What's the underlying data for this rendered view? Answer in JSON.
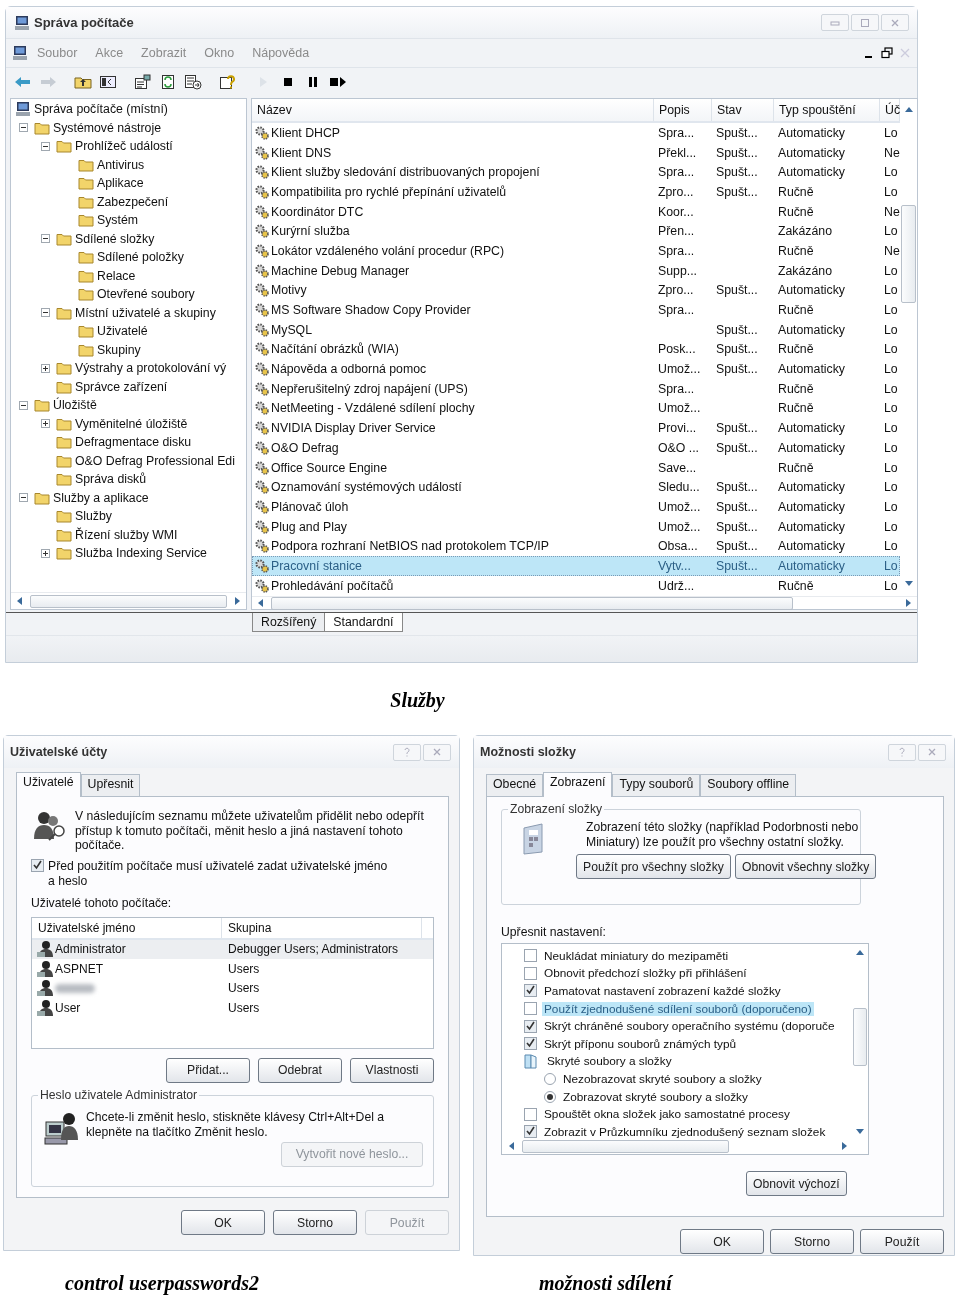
{
  "top_window": {
    "title": "Správa počítače",
    "menu": [
      "Soubor",
      "Akce",
      "Zobrazit",
      "Okno",
      "Nápověda"
    ],
    "tree": [
      {
        "label": "Správa počítače (místní)",
        "children": [
          {
            "label": "Systémové nástroje",
            "expanded": true,
            "children": [
              {
                "label": "Prohlížeč událostí",
                "expanded": true,
                "children": [
                  {
                    "label": "Antivirus"
                  },
                  {
                    "label": "Aplikace"
                  },
                  {
                    "label": "Zabezpečení"
                  },
                  {
                    "label": "Systém"
                  }
                ]
              },
              {
                "label": "Sdílené složky",
                "expanded": true,
                "children": [
                  {
                    "label": "Sdílené položky"
                  },
                  {
                    "label": "Relace"
                  },
                  {
                    "label": "Otevřené soubory"
                  }
                ]
              },
              {
                "label": "Místní uživatelé a skupiny",
                "expanded": true,
                "children": [
                  {
                    "label": "Uživatelé"
                  },
                  {
                    "label": "Skupiny"
                  }
                ]
              },
              {
                "label": "Výstrahy a protokolování vý",
                "expanded": false
              },
              {
                "label": "Správce zařízení"
              }
            ]
          },
          {
            "label": "Úložiště",
            "expanded": true,
            "children": [
              {
                "label": "Vyměnitelné úložiště",
                "expanded": false
              },
              {
                "label": "Defragmentace disku"
              },
              {
                "label": "O&O Defrag Professional Edi"
              },
              {
                "label": "Správa disků"
              }
            ]
          },
          {
            "label": "Služby a aplikace",
            "expanded": true,
            "children": [
              {
                "label": "Služby"
              },
              {
                "label": "Řízení služby WMI"
              },
              {
                "label": "Služba Indexing Service",
                "expanded": false
              }
            ]
          }
        ]
      }
    ],
    "list": {
      "columns": [
        "Název",
        "Popis",
        "Stav",
        "Typ spouštění",
        "Úč"
      ],
      "rows": [
        {
          "name": "Klient DHCP",
          "description": "Spra...",
          "status": "Spušt...",
          "startup": "Automaticky",
          "account": "Lo",
          "selected": false
        },
        {
          "name": "Klient DNS",
          "description": "Překl...",
          "status": "Spušt...",
          "startup": "Automaticky",
          "account": "Ne",
          "selected": false
        },
        {
          "name": "Klient služby sledování distribuovaných propojení",
          "description": "Spra...",
          "status": "Spušt...",
          "startup": "Automaticky",
          "account": "Lo",
          "selected": false
        },
        {
          "name": "Kompatibilita pro rychlé přepínání uživatelů",
          "description": "Zpro...",
          "status": "Spušt...",
          "startup": "Ručně",
          "account": "Lo",
          "selected": false
        },
        {
          "name": "Koordinátor DTC",
          "description": "Koor...",
          "startup": "Ručně",
          "account": "Ne",
          "selected": false
        },
        {
          "name": "Kurýrní služba",
          "description": "Přen...",
          "startup": "Zakázáno",
          "account": "Lo",
          "selected": false
        },
        {
          "name": "Lokátor vzdáleného volání procedur (RPC)",
          "description": "Spra...",
          "startup": "Ručně",
          "account": "Ne",
          "selected": false
        },
        {
          "name": "Machine Debug Manager",
          "description": "Supp...",
          "startup": "Zakázáno",
          "account": "Lo",
          "selected": false
        },
        {
          "name": "Motivy",
          "description": "Zpro...",
          "status": "Spušt...",
          "startup": "Automaticky",
          "account": "Lo",
          "selected": false
        },
        {
          "name": "MS Software Shadow Copy Provider",
          "description": "Spra...",
          "startup": "Ručně",
          "account": "Lo",
          "selected": false
        },
        {
          "name": "MySQL",
          "status": "Spušt...",
          "startup": "Automaticky",
          "account": "Lo",
          "selected": false
        },
        {
          "name": "Načítání obrázků (WIA)",
          "description": "Posk...",
          "status": "Spušt...",
          "startup": "Ručně",
          "account": "Lo",
          "selected": false
        },
        {
          "name": "Nápověda a odborná pomoc",
          "description": "Umož...",
          "status": "Spušt...",
          "startup": "Automaticky",
          "account": "Lo",
          "selected": false
        },
        {
          "name": "Nepřerušitelný zdroj napájení (UPS)",
          "description": "Spra...",
          "startup": "Ručně",
          "account": "Lo",
          "selected": false
        },
        {
          "name": "NetMeeting - Vzdálené sdílení plochy",
          "description": "Umož...",
          "startup": "Ručně",
          "account": "Lo",
          "selected": false
        },
        {
          "name": "NVIDIA Display Driver Service",
          "description": "Provi...",
          "status": "Spušt...",
          "startup": "Automaticky",
          "account": "Lo",
          "selected": false
        },
        {
          "name": "O&O Defrag",
          "description": "O&O ...",
          "status": "Spušt...",
          "startup": "Automaticky",
          "account": "Lo",
          "selected": false
        },
        {
          "name": "Office Source Engine",
          "description": "Save...",
          "startup": "Ručně",
          "account": "Lo",
          "selected": false
        },
        {
          "name": "Oznamování systémových událostí",
          "description": "Sledu...",
          "status": "Spušt...",
          "startup": "Automaticky",
          "account": "Lo",
          "selected": false
        },
        {
          "name": "Plánovač úloh",
          "description": "Umož...",
          "status": "Spušt...",
          "startup": "Automaticky",
          "account": "Lo",
          "selected": false
        },
        {
          "name": "Plug and Play",
          "description": "Umož...",
          "status": "Spušt...",
          "startup": "Automaticky",
          "account": "Lo",
          "selected": false
        },
        {
          "name": "Podpora rozhraní NetBIOS nad protokolem TCP/IP",
          "description": "Obsa...",
          "status": "Spušt...",
          "startup": "Automaticky",
          "account": "Lo",
          "selected": false
        },
        {
          "name": "Pracovní stanice",
          "description": "Vytv...",
          "status": "Spušt...",
          "startup": "Automaticky",
          "account": "Lo",
          "selected": true
        },
        {
          "name": "Prohledávání počítačů",
          "description": "Udrž...",
          "startup": "Ručně",
          "account": "Lo",
          "selected": false
        }
      ]
    },
    "tabs": [
      {
        "label": "Rozšířený",
        "selected": false
      },
      {
        "label": "Standardní",
        "selected": true
      }
    ]
  },
  "caption_1": "Služby",
  "user_accounts": {
    "title": "Uživatelské účty",
    "tabs": [
      {
        "label": "Uživatelé",
        "selected": true
      },
      {
        "label": "Upřesnit",
        "selected": false
      }
    ],
    "intro": "V následujícím seznamu můžete uživatelům přidělit nebo odepřít přístup k tomuto počítači, měnit heslo a jiná nastavení tohoto počítače.",
    "require_login": {
      "label": "Před použitím počítače musí uživatelé zadat uživatelské jméno a heslo",
      "checked": true
    },
    "users_label": "Uživatelé tohoto počítače:",
    "users": {
      "columns": [
        "Uživatelské jméno",
        "Skupina"
      ],
      "rows": [
        {
          "name": "Administrator",
          "group": "Debugger Users; Administrators",
          "redacted": false,
          "selected": true
        },
        {
          "name": "ASPNET",
          "group": "Users",
          "redacted": false,
          "selected": false
        },
        {
          "group": "Users",
          "redacted": true,
          "selected": false
        },
        {
          "name": "User",
          "group": "Users",
          "redacted": false,
          "selected": false
        }
      ]
    },
    "user_buttons": [
      "Přidat...",
      "Odebrat",
      "Vlastnosti"
    ],
    "password_group": {
      "title": "Heslo uživatele Administrator",
      "text": "Chcete-li změnit heslo, stiskněte klávesy Ctrl+Alt+Del a klepněte na tlačítko Změnit heslo.",
      "button": {
        "label": "Vytvořit nové heslo...",
        "disabled": true
      }
    },
    "buttons": [
      {
        "label": "OK",
        "disabled": false
      },
      {
        "label": "Storno",
        "disabled": false
      },
      {
        "label": "Použít",
        "disabled": true
      }
    ]
  },
  "folder_options": {
    "title": "Možnosti složky",
    "tabs": [
      {
        "label": "Obecné",
        "selected": false
      },
      {
        "label": "Zobrazení",
        "selected": true
      },
      {
        "label": "Typy souborů",
        "selected": false
      },
      {
        "label": "Soubory offline",
        "selected": false
      }
    ],
    "folder_view": {
      "title": "Zobrazení složky",
      "text": "Zobrazení této složky  (například Podorbnosti nebo Miniatury) lze použít pro všechny ostatní složky.",
      "buttons": [
        "Použít pro všechny složky",
        "Obnovit všechny složky"
      ]
    },
    "advanced_label": "Upřesnit nastavení:",
    "advanced": [
      {
        "kind": "checkbox",
        "label": "Neukládat miniatury do mezipaměti",
        "checked": false,
        "selected": false
      },
      {
        "kind": "checkbox",
        "label": "Obnovit předchozí složky při přihlášení",
        "checked": false,
        "selected": false
      },
      {
        "kind": "checkbox",
        "label": "Pamatovat nastavení zobrazení každé složky",
        "checked": true,
        "selected": false
      },
      {
        "kind": "checkbox",
        "label": "Použít zjednodušené sdílení souborů (doporučeno)",
        "checked": false,
        "selected": true
      },
      {
        "kind": "checkbox",
        "label": "Skrýt chráněné soubory operačního systému (doporuče",
        "checked": true,
        "selected": false
      },
      {
        "kind": "checkbox",
        "label": "Skrýt příponu souborů známých typů",
        "checked": true,
        "selected": false
      },
      {
        "kind": "folder",
        "label": "Skryté soubory a složky",
        "selected": false
      },
      {
        "kind": "radio",
        "label": "Nezobrazovat skryté soubory a složky",
        "checked": false,
        "selected": false
      },
      {
        "kind": "radio",
        "label": "Zobrazovat skryté soubory a složky",
        "checked": true,
        "selected": false
      },
      {
        "kind": "checkbox",
        "label": "Spouštět okna složek jako samostatné procesy",
        "checked": false,
        "selected": false
      },
      {
        "kind": "checkbox",
        "label": "Zobrazit v Průzkumníku zjednodušený seznam složek",
        "checked": true,
        "selected": false
      }
    ],
    "restore_button": "Obnovit výchozí",
    "buttons": [
      "OK",
      "Storno",
      "Použít"
    ]
  },
  "caption_2": "control userpasswords2",
  "caption_3": "možnosti sdílení"
}
